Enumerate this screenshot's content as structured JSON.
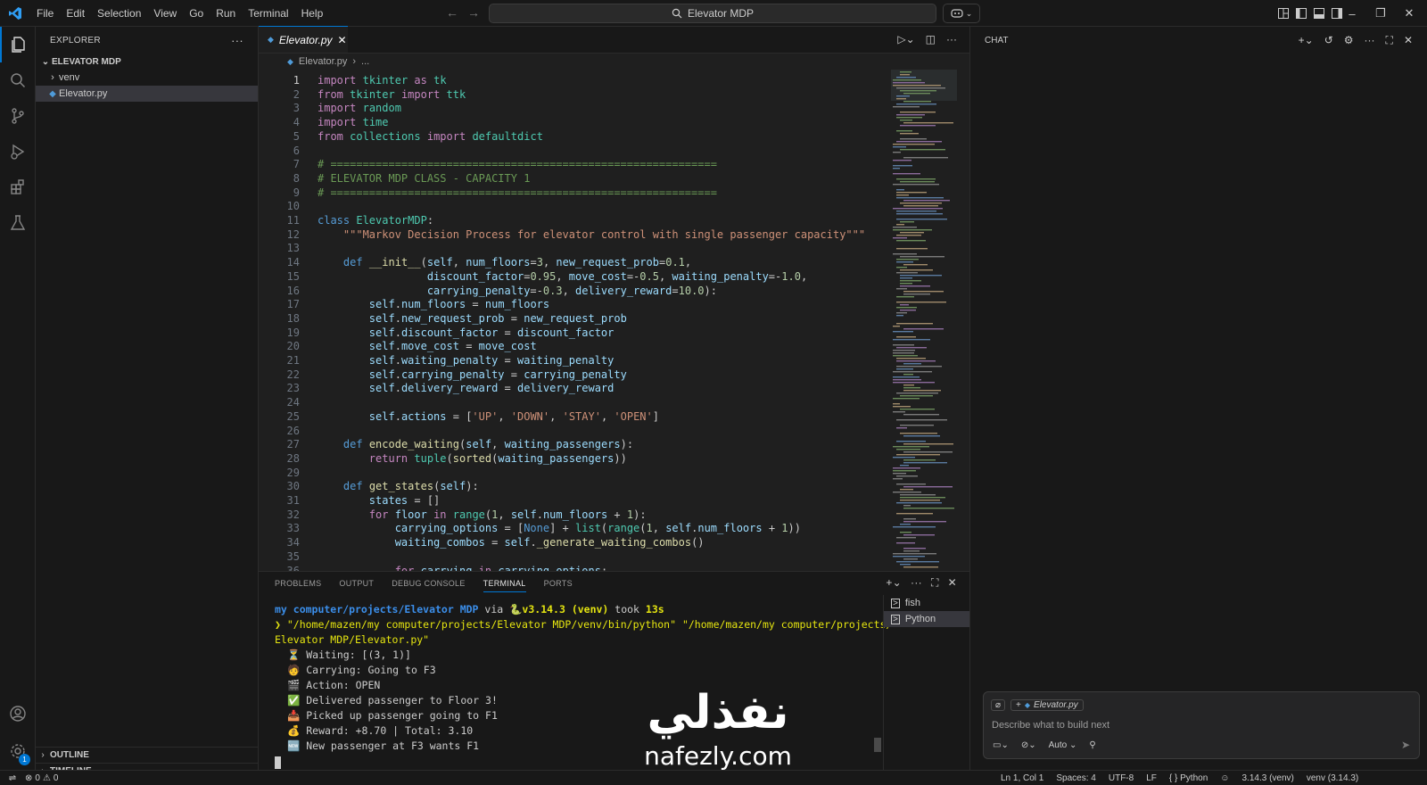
{
  "titlebar": {
    "menu": [
      "File",
      "Edit",
      "Selection",
      "View",
      "Go",
      "Run",
      "Terminal",
      "Help"
    ],
    "search_text": "Elevator MDP"
  },
  "sidebar": {
    "title": "EXPLORER",
    "folder": "ELEVATOR MDP",
    "items": [
      {
        "label": "venv",
        "type": "folder"
      },
      {
        "label": "Elevator.py",
        "type": "file",
        "selected": true
      }
    ],
    "outline": "OUTLINE",
    "timeline": "TIMELINE",
    "account_badge": "1"
  },
  "editor": {
    "tab": "Elevator.py",
    "breadcrumb_file": "Elevator.py",
    "breadcrumb_more": "...",
    "lines": [
      [
        [
          "k",
          "import"
        ],
        [
          "p",
          " "
        ],
        [
          "t",
          "tkinter"
        ],
        [
          "p",
          " "
        ],
        [
          "k",
          "as"
        ],
        [
          "p",
          " "
        ],
        [
          "t",
          "tk"
        ]
      ],
      [
        [
          "k",
          "from"
        ],
        [
          "p",
          " "
        ],
        [
          "t",
          "tkinter"
        ],
        [
          "p",
          " "
        ],
        [
          "k",
          "import"
        ],
        [
          "p",
          " "
        ],
        [
          "t",
          "ttk"
        ]
      ],
      [
        [
          "k",
          "import"
        ],
        [
          "p",
          " "
        ],
        [
          "t",
          "random"
        ]
      ],
      [
        [
          "k",
          "import"
        ],
        [
          "p",
          " "
        ],
        [
          "t",
          "time"
        ]
      ],
      [
        [
          "k",
          "from"
        ],
        [
          "p",
          " "
        ],
        [
          "t",
          "collections"
        ],
        [
          "p",
          " "
        ],
        [
          "k",
          "import"
        ],
        [
          "p",
          " "
        ],
        [
          "t",
          "defaultdict"
        ]
      ],
      [],
      [
        [
          "c",
          "# ============================================================"
        ]
      ],
      [
        [
          "c",
          "# ELEVATOR MDP CLASS - CAPACITY 1"
        ]
      ],
      [
        [
          "c",
          "# ============================================================"
        ]
      ],
      [],
      [
        [
          "kb",
          "class"
        ],
        [
          "p",
          " "
        ],
        [
          "t",
          "ElevatorMDP"
        ],
        [
          "p",
          ":"
        ]
      ],
      [
        [
          "p",
          "    "
        ],
        [
          "s",
          "\"\"\"Markov Decision Process for elevator control with single passenger capacity\"\"\""
        ]
      ],
      [],
      [
        [
          "p",
          "    "
        ],
        [
          "kb",
          "def"
        ],
        [
          "p",
          " "
        ],
        [
          "f",
          "__init__"
        ],
        [
          "p",
          "("
        ],
        [
          "v",
          "self"
        ],
        [
          "p",
          ", "
        ],
        [
          "v",
          "num_floors"
        ],
        [
          "p",
          "="
        ],
        [
          "n",
          "3"
        ],
        [
          "p",
          ", "
        ],
        [
          "v",
          "new_request_prob"
        ],
        [
          "p",
          "="
        ],
        [
          "n",
          "0.1"
        ],
        [
          "p",
          ","
        ]
      ],
      [
        [
          "p",
          "                 "
        ],
        [
          "v",
          "discount_factor"
        ],
        [
          "p",
          "="
        ],
        [
          "n",
          "0.95"
        ],
        [
          "p",
          ", "
        ],
        [
          "v",
          "move_cost"
        ],
        [
          "p",
          "=-"
        ],
        [
          "n",
          "0.5"
        ],
        [
          "p",
          ", "
        ],
        [
          "v",
          "waiting_penalty"
        ],
        [
          "p",
          "=-"
        ],
        [
          "n",
          "1.0"
        ],
        [
          "p",
          ","
        ]
      ],
      [
        [
          "p",
          "                 "
        ],
        [
          "v",
          "carrying_penalty"
        ],
        [
          "p",
          "=-"
        ],
        [
          "n",
          "0.3"
        ],
        [
          "p",
          ", "
        ],
        [
          "v",
          "delivery_reward"
        ],
        [
          "p",
          "="
        ],
        [
          "n",
          "10.0"
        ],
        [
          "p",
          "):"
        ]
      ],
      [
        [
          "p",
          "        "
        ],
        [
          "v",
          "self"
        ],
        [
          "p",
          "."
        ],
        [
          "v",
          "num_floors"
        ],
        [
          "p",
          " = "
        ],
        [
          "v",
          "num_floors"
        ]
      ],
      [
        [
          "p",
          "        "
        ],
        [
          "v",
          "self"
        ],
        [
          "p",
          "."
        ],
        [
          "v",
          "new_request_prob"
        ],
        [
          "p",
          " = "
        ],
        [
          "v",
          "new_request_prob"
        ]
      ],
      [
        [
          "p",
          "        "
        ],
        [
          "v",
          "self"
        ],
        [
          "p",
          "."
        ],
        [
          "v",
          "discount_factor"
        ],
        [
          "p",
          " = "
        ],
        [
          "v",
          "discount_factor"
        ]
      ],
      [
        [
          "p",
          "        "
        ],
        [
          "v",
          "self"
        ],
        [
          "p",
          "."
        ],
        [
          "v",
          "move_cost"
        ],
        [
          "p",
          " = "
        ],
        [
          "v",
          "move_cost"
        ]
      ],
      [
        [
          "p",
          "        "
        ],
        [
          "v",
          "self"
        ],
        [
          "p",
          "."
        ],
        [
          "v",
          "waiting_penalty"
        ],
        [
          "p",
          " = "
        ],
        [
          "v",
          "waiting_penalty"
        ]
      ],
      [
        [
          "p",
          "        "
        ],
        [
          "v",
          "self"
        ],
        [
          "p",
          "."
        ],
        [
          "v",
          "carrying_penalty"
        ],
        [
          "p",
          " = "
        ],
        [
          "v",
          "carrying_penalty"
        ]
      ],
      [
        [
          "p",
          "        "
        ],
        [
          "v",
          "self"
        ],
        [
          "p",
          "."
        ],
        [
          "v",
          "delivery_reward"
        ],
        [
          "p",
          " = "
        ],
        [
          "v",
          "delivery_reward"
        ]
      ],
      [],
      [
        [
          "p",
          "        "
        ],
        [
          "v",
          "self"
        ],
        [
          "p",
          "."
        ],
        [
          "v",
          "actions"
        ],
        [
          "p",
          " = ["
        ],
        [
          "s",
          "'UP'"
        ],
        [
          "p",
          ", "
        ],
        [
          "s",
          "'DOWN'"
        ],
        [
          "p",
          ", "
        ],
        [
          "s",
          "'STAY'"
        ],
        [
          "p",
          ", "
        ],
        [
          "s",
          "'OPEN'"
        ],
        [
          "p",
          "]"
        ]
      ],
      [],
      [
        [
          "p",
          "    "
        ],
        [
          "kb",
          "def"
        ],
        [
          "p",
          " "
        ],
        [
          "f",
          "encode_waiting"
        ],
        [
          "p",
          "("
        ],
        [
          "v",
          "self"
        ],
        [
          "p",
          ", "
        ],
        [
          "v",
          "waiting_passengers"
        ],
        [
          "p",
          "):"
        ]
      ],
      [
        [
          "p",
          "        "
        ],
        [
          "k",
          "return"
        ],
        [
          "p",
          " "
        ],
        [
          "t",
          "tuple"
        ],
        [
          "p",
          "("
        ],
        [
          "f",
          "sorted"
        ],
        [
          "p",
          "("
        ],
        [
          "v",
          "waiting_passengers"
        ],
        [
          "p",
          "))"
        ]
      ],
      [],
      [
        [
          "p",
          "    "
        ],
        [
          "kb",
          "def"
        ],
        [
          "p",
          " "
        ],
        [
          "f",
          "get_states"
        ],
        [
          "p",
          "("
        ],
        [
          "v",
          "self"
        ],
        [
          "p",
          "):"
        ]
      ],
      [
        [
          "p",
          "        "
        ],
        [
          "v",
          "states"
        ],
        [
          "p",
          " = []"
        ]
      ],
      [
        [
          "p",
          "        "
        ],
        [
          "k",
          "for"
        ],
        [
          "p",
          " "
        ],
        [
          "v",
          "floor"
        ],
        [
          "p",
          " "
        ],
        [
          "k",
          "in"
        ],
        [
          "p",
          " "
        ],
        [
          "t",
          "range"
        ],
        [
          "p",
          "("
        ],
        [
          "n",
          "1"
        ],
        [
          "p",
          ", "
        ],
        [
          "v",
          "self"
        ],
        [
          "p",
          "."
        ],
        [
          "v",
          "num_floors"
        ],
        [
          "p",
          " + "
        ],
        [
          "n",
          "1"
        ],
        [
          "p",
          "):"
        ]
      ],
      [
        [
          "p",
          "            "
        ],
        [
          "v",
          "carrying_options"
        ],
        [
          "p",
          " = ["
        ],
        [
          "kb",
          "None"
        ],
        [
          "p",
          "] + "
        ],
        [
          "t",
          "list"
        ],
        [
          "p",
          "("
        ],
        [
          "t",
          "range"
        ],
        [
          "p",
          "("
        ],
        [
          "n",
          "1"
        ],
        [
          "p",
          ", "
        ],
        [
          "v",
          "self"
        ],
        [
          "p",
          "."
        ],
        [
          "v",
          "num_floors"
        ],
        [
          "p",
          " + "
        ],
        [
          "n",
          "1"
        ],
        [
          "p",
          "))"
        ]
      ],
      [
        [
          "p",
          "            "
        ],
        [
          "v",
          "waiting_combos"
        ],
        [
          "p",
          " = "
        ],
        [
          "v",
          "self"
        ],
        [
          "p",
          "."
        ],
        [
          "f",
          "_generate_waiting_combos"
        ],
        [
          "p",
          "()"
        ]
      ],
      [],
      [
        [
          "p",
          "            "
        ],
        [
          "k",
          "for"
        ],
        [
          "p",
          " "
        ],
        [
          "v",
          "carrying"
        ],
        [
          "p",
          " "
        ],
        [
          "k",
          "in"
        ],
        [
          "p",
          " "
        ],
        [
          "v",
          "carrying_options"
        ],
        [
          "p",
          ":"
        ]
      ]
    ]
  },
  "panel": {
    "tabs": [
      "PROBLEMS",
      "OUTPUT",
      "DEBUG CONSOLE",
      "TERMINAL",
      "PORTS"
    ],
    "active_tab": "TERMINAL",
    "terminal": {
      "prompt_path": "my computer/projects/Elevator MDP",
      "prompt_via": " via ",
      "prompt_env": "🐍v3.14.3 (venv)",
      "prompt_took": " took ",
      "prompt_time": "13s",
      "command_line1": "❯ \"/home/mazen/my computer/projects/Elevator MDP/venv/bin/python\" \"/home/mazen/my computer/projects/",
      "command_line2": "Elevator MDP/Elevator.py\"",
      "output": [
        "⏳ Waiting: [(3, 1)]",
        "🧑 Carrying: Going to F3",
        "🎬 Action: OPEN",
        "✅ Delivered passenger to Floor 3!",
        "📥 Picked up passenger going to F1",
        "💰 Reward: +8.70 | Total: 3.10",
        "🆕 New passenger at F3 wants F1"
      ]
    },
    "terminals": [
      {
        "label": "fish",
        "selected": false
      },
      {
        "label": "Python",
        "selected": true
      }
    ]
  },
  "chat": {
    "title": "CHAT",
    "context_file": "Elevator.py",
    "placeholder": "Describe what to build next",
    "mode": "Auto"
  },
  "statusbar": {
    "errors": "0",
    "warnings": "0",
    "position": "Ln 1, Col 1",
    "spaces": "Spaces: 4",
    "encoding": "UTF-8",
    "eol": "LF",
    "language": "Python",
    "py_version": "3.14.3 (venv)",
    "env": "venv (3.14.3)"
  },
  "watermark": {
    "arabic": "نفذلي",
    "latin": "nafezly.com"
  },
  "colors": {
    "accent": "#0078d4",
    "background": "#1f1f1f",
    "sidebar": "#181818"
  },
  "icons": [
    "vscode-logo-icon",
    "explorer-icon",
    "search-icon",
    "source-control-icon",
    "run-debug-icon",
    "extensions-icon",
    "testing-icon",
    "account-icon",
    "settings-icon",
    "python-file-icon",
    "terminal-icon"
  ]
}
